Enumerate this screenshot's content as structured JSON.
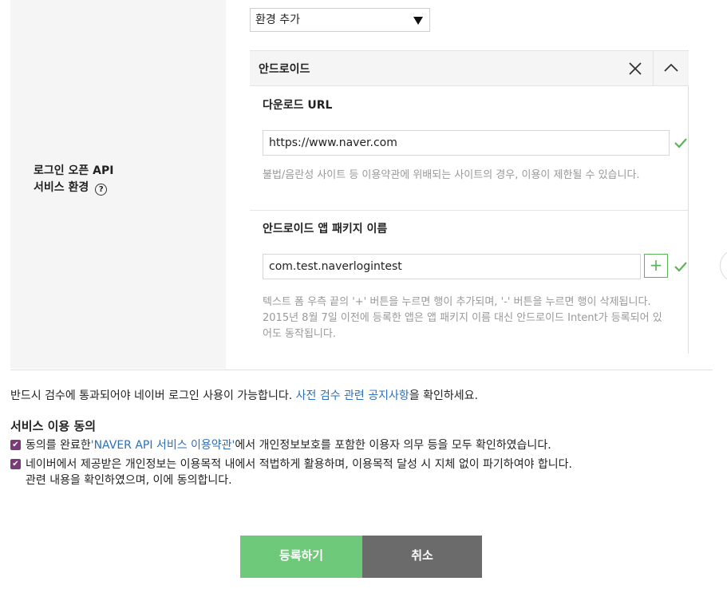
{
  "env_select": {
    "value": "환경 추가"
  },
  "field_label": {
    "line1": "로그인 오픈 API",
    "line2": "서비스 환경",
    "help_glyph": "?"
  },
  "platform": {
    "title": "안드로이드",
    "download_url": {
      "title": "다운로드 URL",
      "value": "https://www.naver.com",
      "note": "불법/음란성 사이트 등 이용약관에 위배되는 사이트의 경우, 이용이 제한될 수 있습니다."
    },
    "package_name": {
      "title": "안드로이드 앱 패키지 이름",
      "value": "com.test.naverlogintest",
      "plus_label": "+",
      "note_line1": "텍스트 폼 우측 끝의 '+' 버튼을 누르면 행이 추가되며, '-' 버튼을 누르면 행이 삭제됩니다.",
      "note_line2": "2015년 8월 7일 이전에 등록한 앱은 앱 패키지 이름 대신 안드로이드 Intent가 등록되어 있",
      "note_line3": "어도 동작됩니다."
    }
  },
  "review_notice": {
    "prefix": "반드시 검수에 통과되어야 네이버 로그인 사용이 가능합니다. ",
    "link": "사전 검수 관련 공지사항",
    "suffix": "을 확인하세요."
  },
  "consent": {
    "title": "서비스 이용 동의",
    "item1": {
      "prefix": "동의를 완료한",
      "link": "'NAVER API 서비스 이용약관'",
      "suffix": "에서 개인정보보호를 포함한 이용자 의무 등을 모두 확인하였습니다."
    },
    "item2": {
      "line1": "네이버에서 제공받은 개인정보는 이용목적 내에서 적법하게 활용하며, 이용목적 달성 시 지체 없이 파기하여야 합니다.",
      "line2": "관련 내용을 확인하였으며, 이에 동의합니다."
    },
    "check_glyph": "✔"
  },
  "buttons": {
    "register": "등록하기",
    "cancel": "취소"
  },
  "colors": {
    "accent_green": "#6fc97b",
    "check_green": "#5ab45a",
    "link_blue": "#2d6fb8",
    "cancel_gray": "#6b6b6b",
    "checkbox_purple": "#7b3a7a"
  }
}
